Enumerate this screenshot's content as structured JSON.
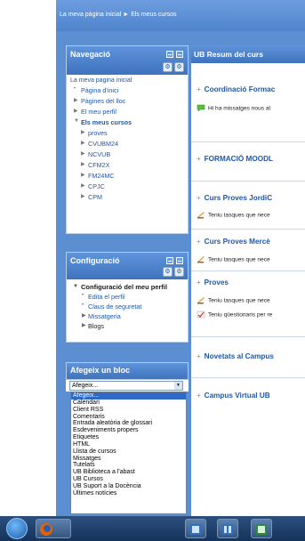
{
  "breadcrumb": {
    "home": "La meva pàgina inicial",
    "arrow": "►",
    "current": "Els meus cursos"
  },
  "navigation": {
    "title": "Navegació",
    "root": "La meva pagina inicial",
    "items": [
      {
        "label": "Pàgina d'inici",
        "marker": "•",
        "level": 1
      },
      {
        "label": "Pàgines del lloc",
        "marker": "▶",
        "level": 1
      },
      {
        "label": "El meu perfil",
        "marker": "▶",
        "level": 1
      },
      {
        "label": "Els meus cursos",
        "marker": "▼",
        "level": 1,
        "bold": true
      },
      {
        "label": "proves",
        "marker": "▶",
        "level": 2
      },
      {
        "label": "CVUBM24",
        "marker": "▶",
        "level": 2
      },
      {
        "label": "NCVUB",
        "marker": "▶",
        "level": 2
      },
      {
        "label": "CFM2X",
        "marker": "▶",
        "level": 2
      },
      {
        "label": "FM24MC",
        "marker": "▶",
        "level": 2
      },
      {
        "label": "CPJC",
        "marker": "▶",
        "level": 2
      },
      {
        "label": "CPM",
        "marker": "▶",
        "level": 2
      }
    ]
  },
  "configuration": {
    "title": "Configuració",
    "heading": "Configuració del meu perfil",
    "items": [
      {
        "label": "Edita el perfil",
        "marker": "•"
      },
      {
        "label": "Claus de seguretat",
        "marker": "•"
      },
      {
        "label": "Missatgeria",
        "marker": "▶"
      },
      {
        "label": "Blogs",
        "marker": "▶"
      }
    ]
  },
  "add_block": {
    "title": "Afegeix un bloc",
    "selected": "Afegeix...",
    "options": [
      "Afegeix...",
      "Calendari",
      "Client RSS",
      "Comentaris",
      "Entrada aleatòria de glossari",
      "Esdeveniments propers",
      "Etiquetes",
      "HTML",
      "Llista de cursos",
      "Missatges",
      "Tutelats",
      "UB Biblioteca a l'abast",
      "UB Cursos",
      "UB Suport a la Docència",
      "Últimes notícies"
    ]
  },
  "course_overview": {
    "title": "UB Resum del curs",
    "courses": [
      {
        "name": "Coordinació Formac",
        "note": "Hi ha missatges nous al",
        "note_icon": "message-icon"
      },
      {
        "name": "FORMACIÓ MOODL",
        "note": ""
      },
      {
        "name": "Curs Proves JordiC",
        "note": "Teniu tasques que nece",
        "note_icon": "assignment-icon"
      },
      {
        "name": "Curs Proves Mercè",
        "note": "Teniu tasques que nece",
        "note_icon": "assignment-icon"
      },
      {
        "name": "Proves",
        "note": "Teniu tasques que nece",
        "note2": "Teniu qüestionaris per re",
        "note_icon": "assignment-icon"
      },
      {
        "name": "Novetats al Campus",
        "note": ""
      },
      {
        "name": "Campus Virtual UB",
        "note": ""
      }
    ]
  },
  "colors": {
    "header_blue": "#4f84cc",
    "link_blue": "#1f57a8",
    "selected": "#3169c6"
  }
}
